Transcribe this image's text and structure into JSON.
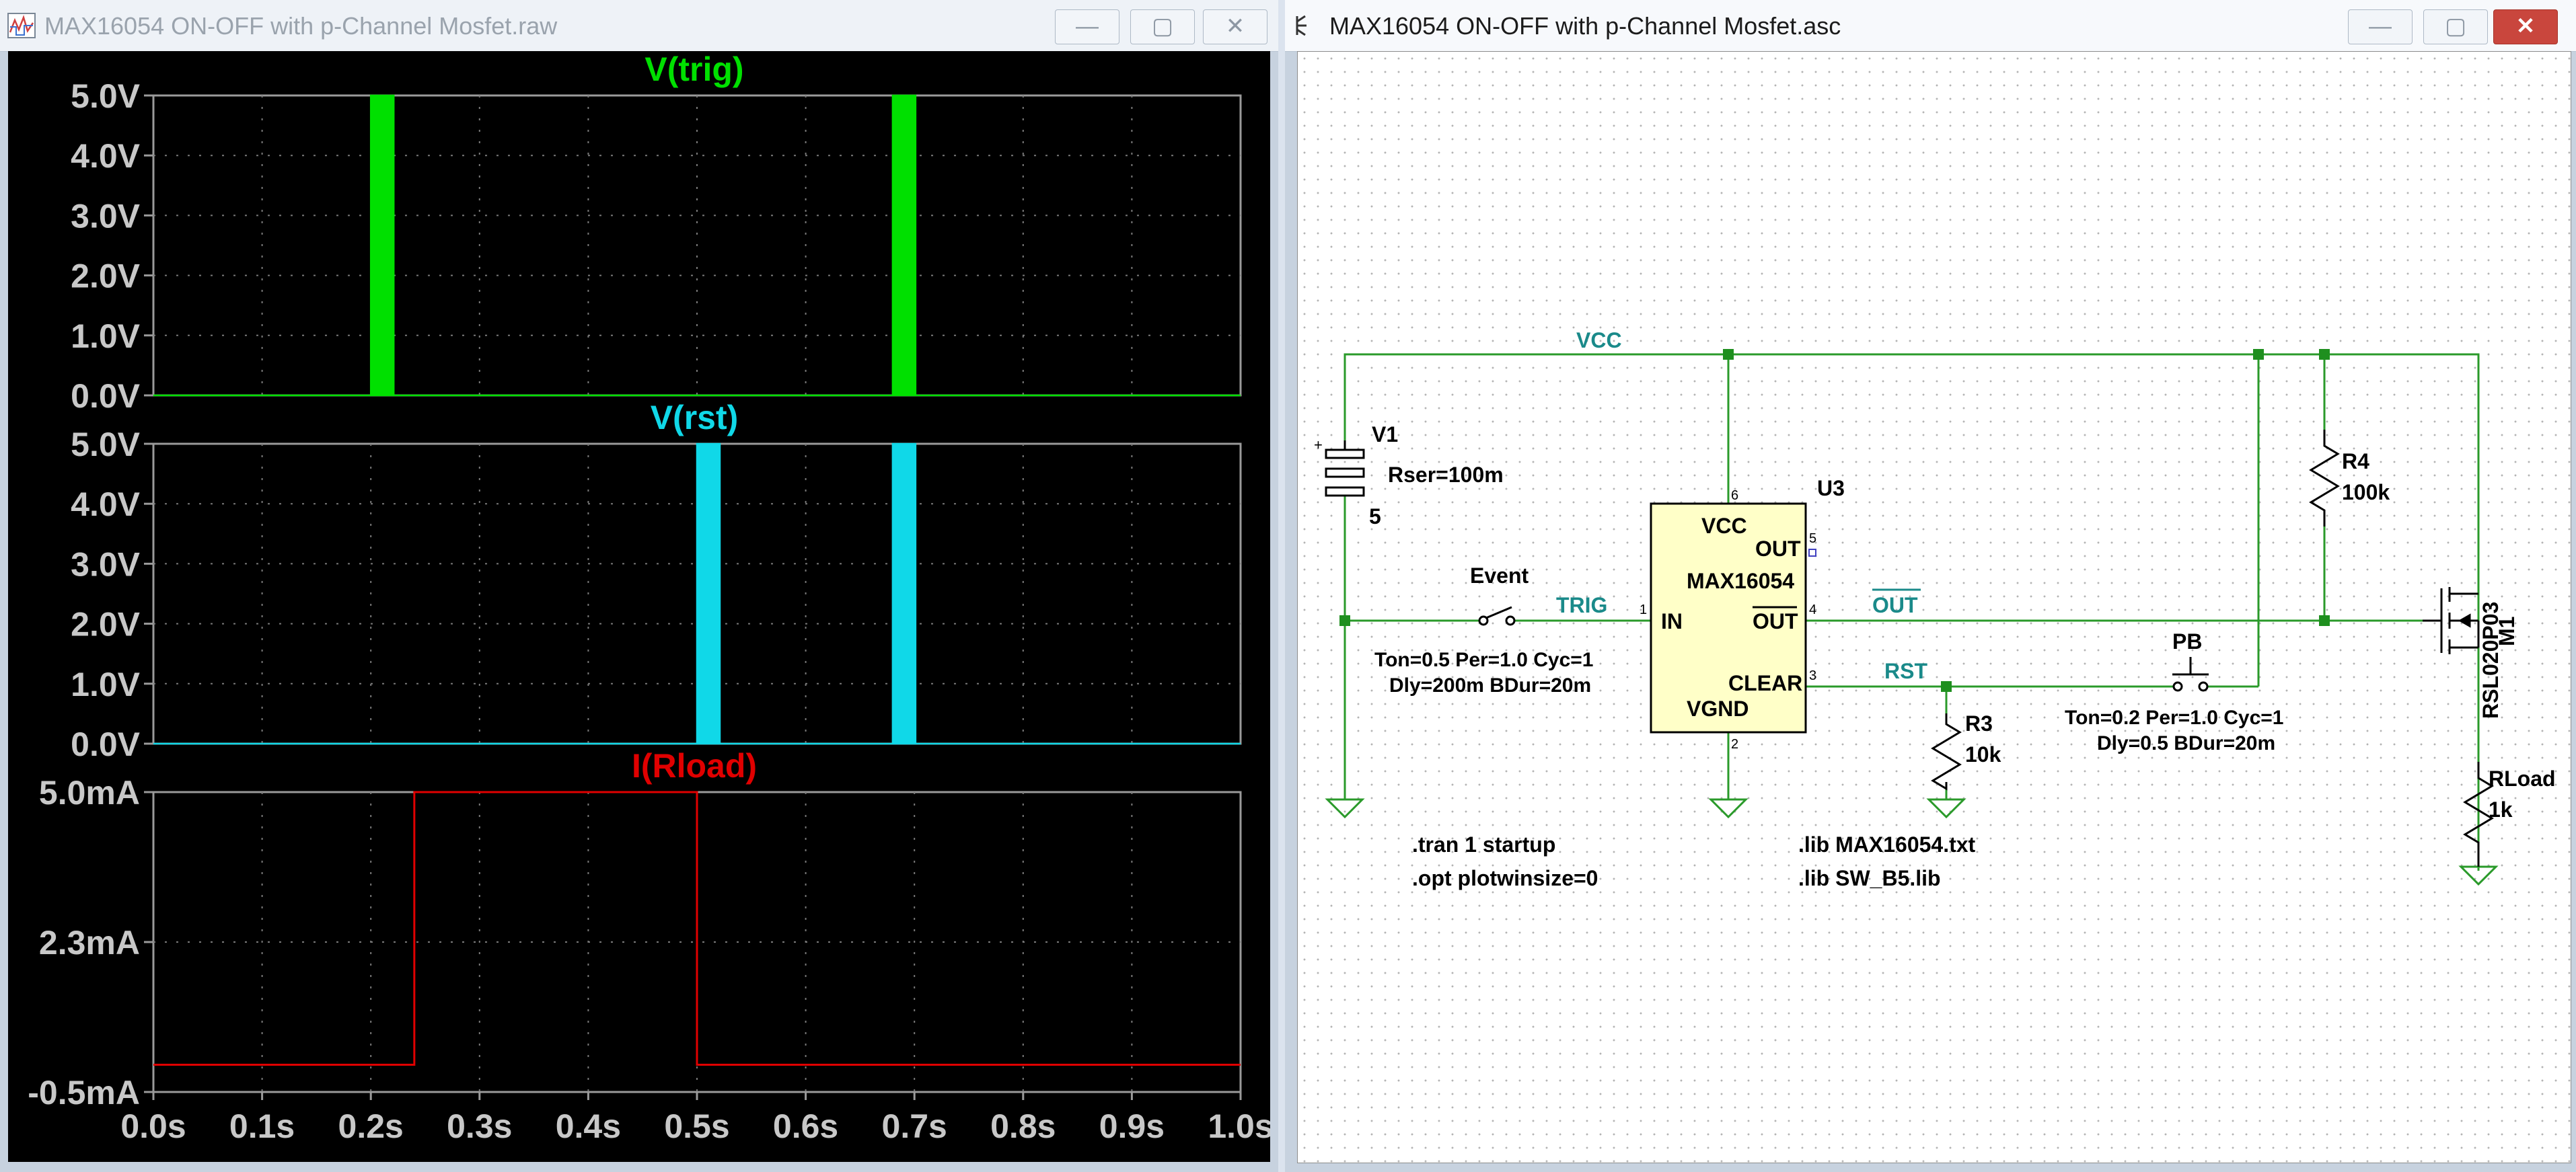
{
  "plot_window": {
    "title": "MAX16054 ON-OFF with p-Channel Mosfet.raw",
    "buttons": {
      "minimize": "—",
      "maximize": "▢",
      "close": "✕"
    }
  },
  "schematic_window": {
    "title": "MAX16054 ON-OFF with p-Channel Mosfet.asc",
    "buttons": {
      "minimize": "—",
      "maximize": "▢",
      "close": "✕"
    }
  },
  "colors": {
    "trig": "#00e000",
    "rst": "#10d8e8",
    "rload": "#e00000",
    "wire": "#2a9a2a",
    "net_label": "#1a8a8a"
  },
  "chart_data": [
    {
      "type": "line",
      "title": "V(trig)",
      "ylim": [
        0,
        5
      ],
      "yticks": [
        "5.0V",
        "4.0V",
        "3.0V",
        "2.0V",
        "1.0V",
        "0.0V"
      ],
      "pulses": [
        {
          "t_start": 0.2,
          "t_end": 0.22
        },
        {
          "t_start": 0.68,
          "t_end": 0.7
        }
      ]
    },
    {
      "type": "line",
      "title": "V(rst)",
      "ylim": [
        0,
        5
      ],
      "yticks": [
        "5.0V",
        "4.0V",
        "3.0V",
        "2.0V",
        "1.0V",
        "0.0V"
      ],
      "pulses": [
        {
          "t_start": 0.5,
          "t_end": 0.52
        },
        {
          "t_start": 0.68,
          "t_end": 0.7
        }
      ]
    },
    {
      "type": "line",
      "title": "I(Rload)",
      "ylim": [
        -0.5,
        5.0
      ],
      "yticks": [
        "5.0mA",
        "2.3mA",
        "-0.5mA"
      ],
      "x": [
        0.0,
        0.24,
        0.24,
        0.5,
        0.5,
        1.0
      ],
      "y": [
        0.0,
        0.0,
        5.0,
        5.0,
        0.0,
        0.0
      ]
    }
  ],
  "x_axis_ticks": [
    "0.0s",
    "0.1s",
    "0.2s",
    "0.3s",
    "0.4s",
    "0.5s",
    "0.6s",
    "0.7s",
    "0.8s",
    "0.9s",
    "1.0s"
  ],
  "schematic": {
    "net_vcc": "VCC",
    "net_trig": "TRIG",
    "net_out": "OUT",
    "net_rst": "RST",
    "v1": {
      "name": "V1",
      "param": "Rser=100m",
      "value": "5"
    },
    "u3": {
      "name": "U3",
      "part": "MAX16054",
      "pins": {
        "vcc": "VCC",
        "out": "OUT",
        "in": "IN",
        "outbar": "OUT",
        "clear": "CLEAR",
        "vgnd": "VGND"
      },
      "pin_numbers": [
        "6",
        "5",
        "1",
        "4",
        "3",
        "2"
      ]
    },
    "event": {
      "name": "Event",
      "line1": "Ton=0.5 Per=1.0 Cyc=1",
      "line2": "Dly=200m BDur=20m"
    },
    "pb": {
      "name": "PB",
      "line1": "Ton=0.2 Per=1.0 Cyc=1",
      "line2": "Dly=0.5 BDur=20m"
    },
    "r4": {
      "name": "R4",
      "value": "100k"
    },
    "r3": {
      "name": "R3",
      "value": "10k"
    },
    "rload": {
      "name": "RLoad",
      "value": "1k"
    },
    "m1": {
      "name": "M1",
      "part": "RSL020P03"
    },
    "directives": [
      ".tran 1 startup",
      ".opt plotwinsize=0"
    ],
    "libs": [
      ".lib MAX16054.txt",
      ".lib SW_B5.lib"
    ]
  }
}
